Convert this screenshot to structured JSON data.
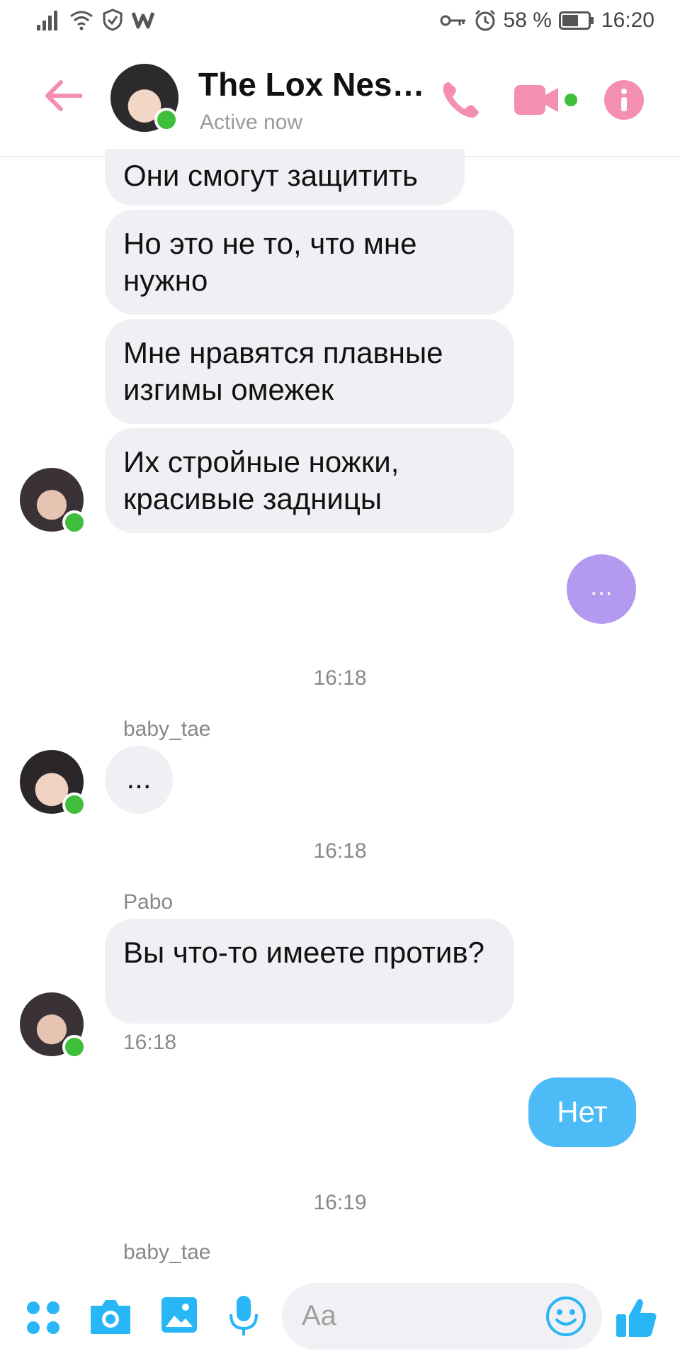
{
  "status_bar": {
    "battery": "58 %",
    "time": "16:20"
  },
  "header": {
    "title": "The Lox Nes…",
    "subtitle": "Active now"
  },
  "messages": {
    "b1": "Они смогут защитить",
    "b2": "Но это не то, что мне нужно",
    "b3": "Мне нравятся плавные изгимы омежек",
    "b4": "Их стройные ножки, красивые задницы",
    "typing": "…",
    "t1": "16:18",
    "sender_baby_tae": "baby_tae",
    "dots_msg": "...",
    "t2": "16:18",
    "sender_pabo": "Pabo",
    "pabo_msg": "Вы что-то имеете против?",
    "pabo_time": "16:18",
    "sent_msg": "Нет",
    "t3": "16:19",
    "sender_baby_tae_2": "baby_tae"
  },
  "composer": {
    "placeholder": "Aa"
  },
  "colors": {
    "accent_pink": "#f48fb1",
    "sent_blue": "#4dbbf5",
    "typing_purple": "#b39af0",
    "online_green": "#3fbe3c",
    "toolbar_blue": "#29b6f6"
  }
}
